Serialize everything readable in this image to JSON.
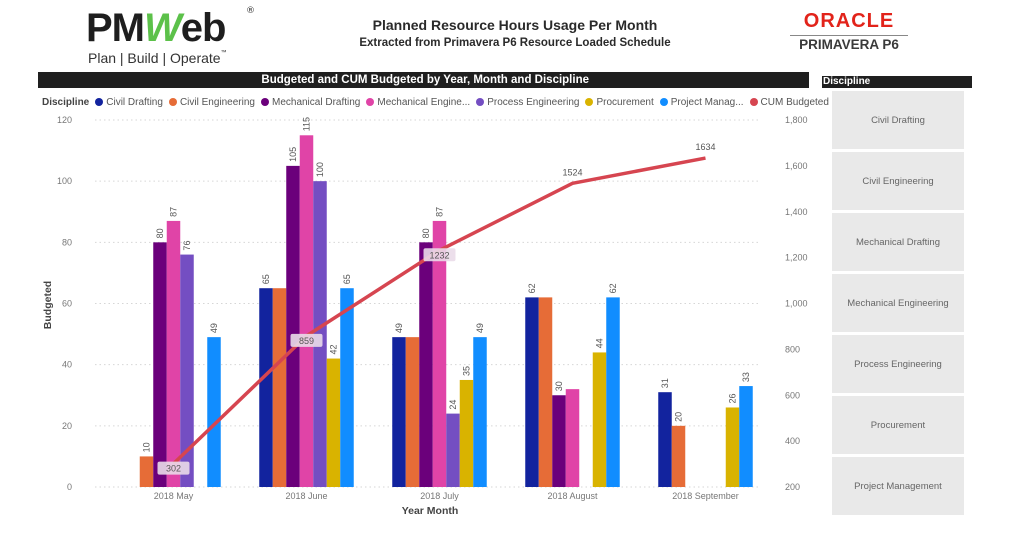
{
  "header": {
    "logo": {
      "brand_left": "PM",
      "brand_w": "W",
      "brand_right": "eb",
      "registered": "®",
      "tagline": "Plan | Build | Operate",
      "tagline_tm": "™"
    },
    "title": "Planned Resource Hours Usage Per Month",
    "subtitle": "Extracted from Primavera P6 Resource Loaded Schedule",
    "partner_logo": {
      "top": "ORACLE",
      "bottom": "PRIMAVERA P6",
      "color": "#e2231a"
    }
  },
  "chart_data": {
    "type": "bar+line",
    "title": "Budgeted and CUM Budgeted by Year, Month and Discipline",
    "legend_title": "Discipline",
    "legend_position": "top-left",
    "xlabel": "Year Month",
    "ylabel": "Budgeted",
    "y2label": "",
    "ylim": [
      0,
      120
    ],
    "y_ticks": [
      0,
      20,
      40,
      60,
      80,
      100,
      120
    ],
    "y_tick_labels": [
      "0",
      "20",
      "40",
      "60",
      "80",
      "100",
      "120"
    ],
    "y2lim": [
      200,
      1800
    ],
    "y2_ticks": [
      200,
      400,
      600,
      800,
      1000,
      1200,
      1400,
      1600,
      1800
    ],
    "y2_tick_labels": [
      "200",
      "400",
      "600",
      "800",
      "1,000",
      "1,200",
      "1,400",
      "1,600",
      "1,800"
    ],
    "grid": true,
    "categories": [
      "2018 May",
      "2018 June",
      "2018 July",
      "2018 August",
      "2018 September"
    ],
    "series": [
      {
        "name": "Civil Drafting",
        "legend_label": "Civil Drafting",
        "color": "#12239e",
        "values": [
          null,
          65,
          49,
          62,
          31
        ],
        "labels": [
          null,
          "65",
          "49",
          "62",
          "31"
        ]
      },
      {
        "name": "Civil Engineering",
        "legend_label": "Civil Engineering",
        "color": "#e66c37",
        "values": [
          10,
          65,
          49,
          62,
          20
        ],
        "labels": [
          "10",
          null,
          null,
          null,
          "20"
        ]
      },
      {
        "name": "Mechanical Drafting",
        "legend_label": "Mechanical Drafting",
        "color": "#6b007b",
        "values": [
          80,
          105,
          80,
          30,
          null
        ],
        "labels": [
          "80",
          "105",
          "80",
          "30",
          null
        ]
      },
      {
        "name": "Mechanical Engineering",
        "legend_label": "Mechanical Engine...",
        "color": "#e044a7",
        "values": [
          87,
          115,
          87,
          32,
          null
        ],
        "labels": [
          "87",
          "115",
          "87",
          null,
          null
        ]
      },
      {
        "name": "Process Engineering",
        "legend_label": "Process Engineering",
        "color": "#744ec2",
        "values": [
          76,
          100,
          24,
          null,
          null
        ],
        "labels": [
          "76",
          "100",
          "24",
          null,
          null
        ]
      },
      {
        "name": "Procurement",
        "legend_label": "Procurement",
        "color": "#d9b300",
        "values": [
          null,
          42,
          35,
          44,
          26
        ],
        "labels": [
          null,
          "42",
          "35",
          "44",
          "26"
        ]
      },
      {
        "name": "Project Management",
        "legend_label": "Project Manag...",
        "color": "#118dff",
        "values": [
          49,
          65,
          49,
          62,
          33
        ],
        "labels": [
          "49",
          "65",
          "49",
          "62",
          "33"
        ]
      }
    ],
    "line_series": {
      "name": "CUM Budgeted",
      "legend_label": "CUM Budgeted",
      "color": "#d64550",
      "axis": "right",
      "values": [
        302,
        859,
        1232,
        1524,
        1634
      ],
      "labels": [
        "302",
        "859",
        "1232",
        "1524",
        "1634"
      ]
    }
  },
  "slicer": {
    "title": "Discipline",
    "items": [
      "Civil Drafting",
      "Civil Engineering",
      "Mechanical Drafting",
      "Mechanical Engineering",
      "Process Engineering",
      "Procurement",
      "Project Management"
    ]
  }
}
